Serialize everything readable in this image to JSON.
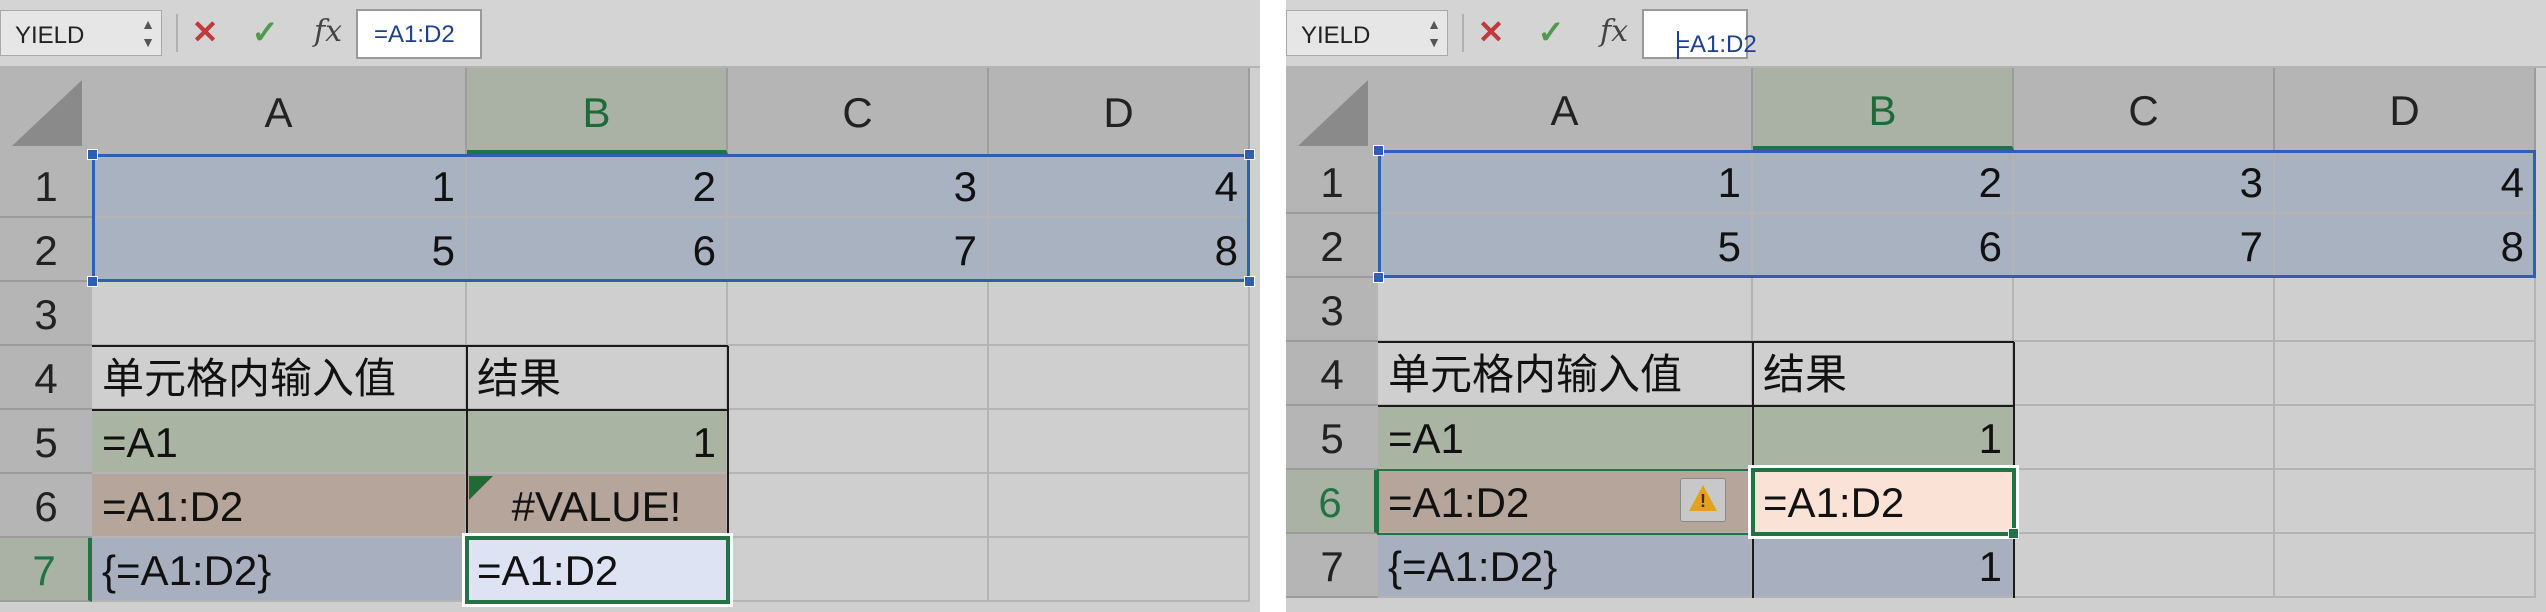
{
  "colors": {
    "accent": "#217346",
    "selection": "#2f5fb3",
    "error_red": "#c0393b",
    "confirm_green": "#4f9a4f",
    "warning": "#e3a21a"
  },
  "icons": [
    "cancel-x-icon",
    "confirm-check-icon",
    "fx-icon",
    "spinner-arrows-icon",
    "warning-icon",
    "select-all-triangle-icon"
  ],
  "left": {
    "name_box": "YIELD",
    "formula": "=A1:D2",
    "fx_label": "fx",
    "columns": [
      "A",
      "B",
      "C",
      "D"
    ],
    "rows": [
      "1",
      "2",
      "3",
      "4",
      "5",
      "6",
      "7"
    ],
    "data_rows": [
      [
        "1",
        "2",
        "3",
        "4"
      ],
      [
        "5",
        "6",
        "7",
        "8"
      ]
    ],
    "table": {
      "header": [
        "单元格内输入值",
        "结果"
      ],
      "rows": [
        [
          "=A1",
          "1"
        ],
        [
          "=A1:D2",
          "#VALUE!"
        ],
        [
          "{=A1:D2}",
          "=A1:D2"
        ]
      ]
    }
  },
  "right": {
    "name_box": "YIELD",
    "formula": "=A1:D2",
    "fx_label": "fx",
    "columns": [
      "A",
      "B",
      "C",
      "D"
    ],
    "rows": [
      "1",
      "2",
      "3",
      "4",
      "5",
      "6",
      "7"
    ],
    "data_rows": [
      [
        "1",
        "2",
        "3",
        "4"
      ],
      [
        "5",
        "6",
        "7",
        "8"
      ]
    ],
    "table": {
      "header": [
        "单元格内输入值",
        "结果"
      ],
      "rows": [
        [
          "=A1",
          "1"
        ],
        [
          "=A1:D2",
          "=A1:D2"
        ],
        [
          "{=A1:D2}",
          "1"
        ]
      ]
    }
  }
}
